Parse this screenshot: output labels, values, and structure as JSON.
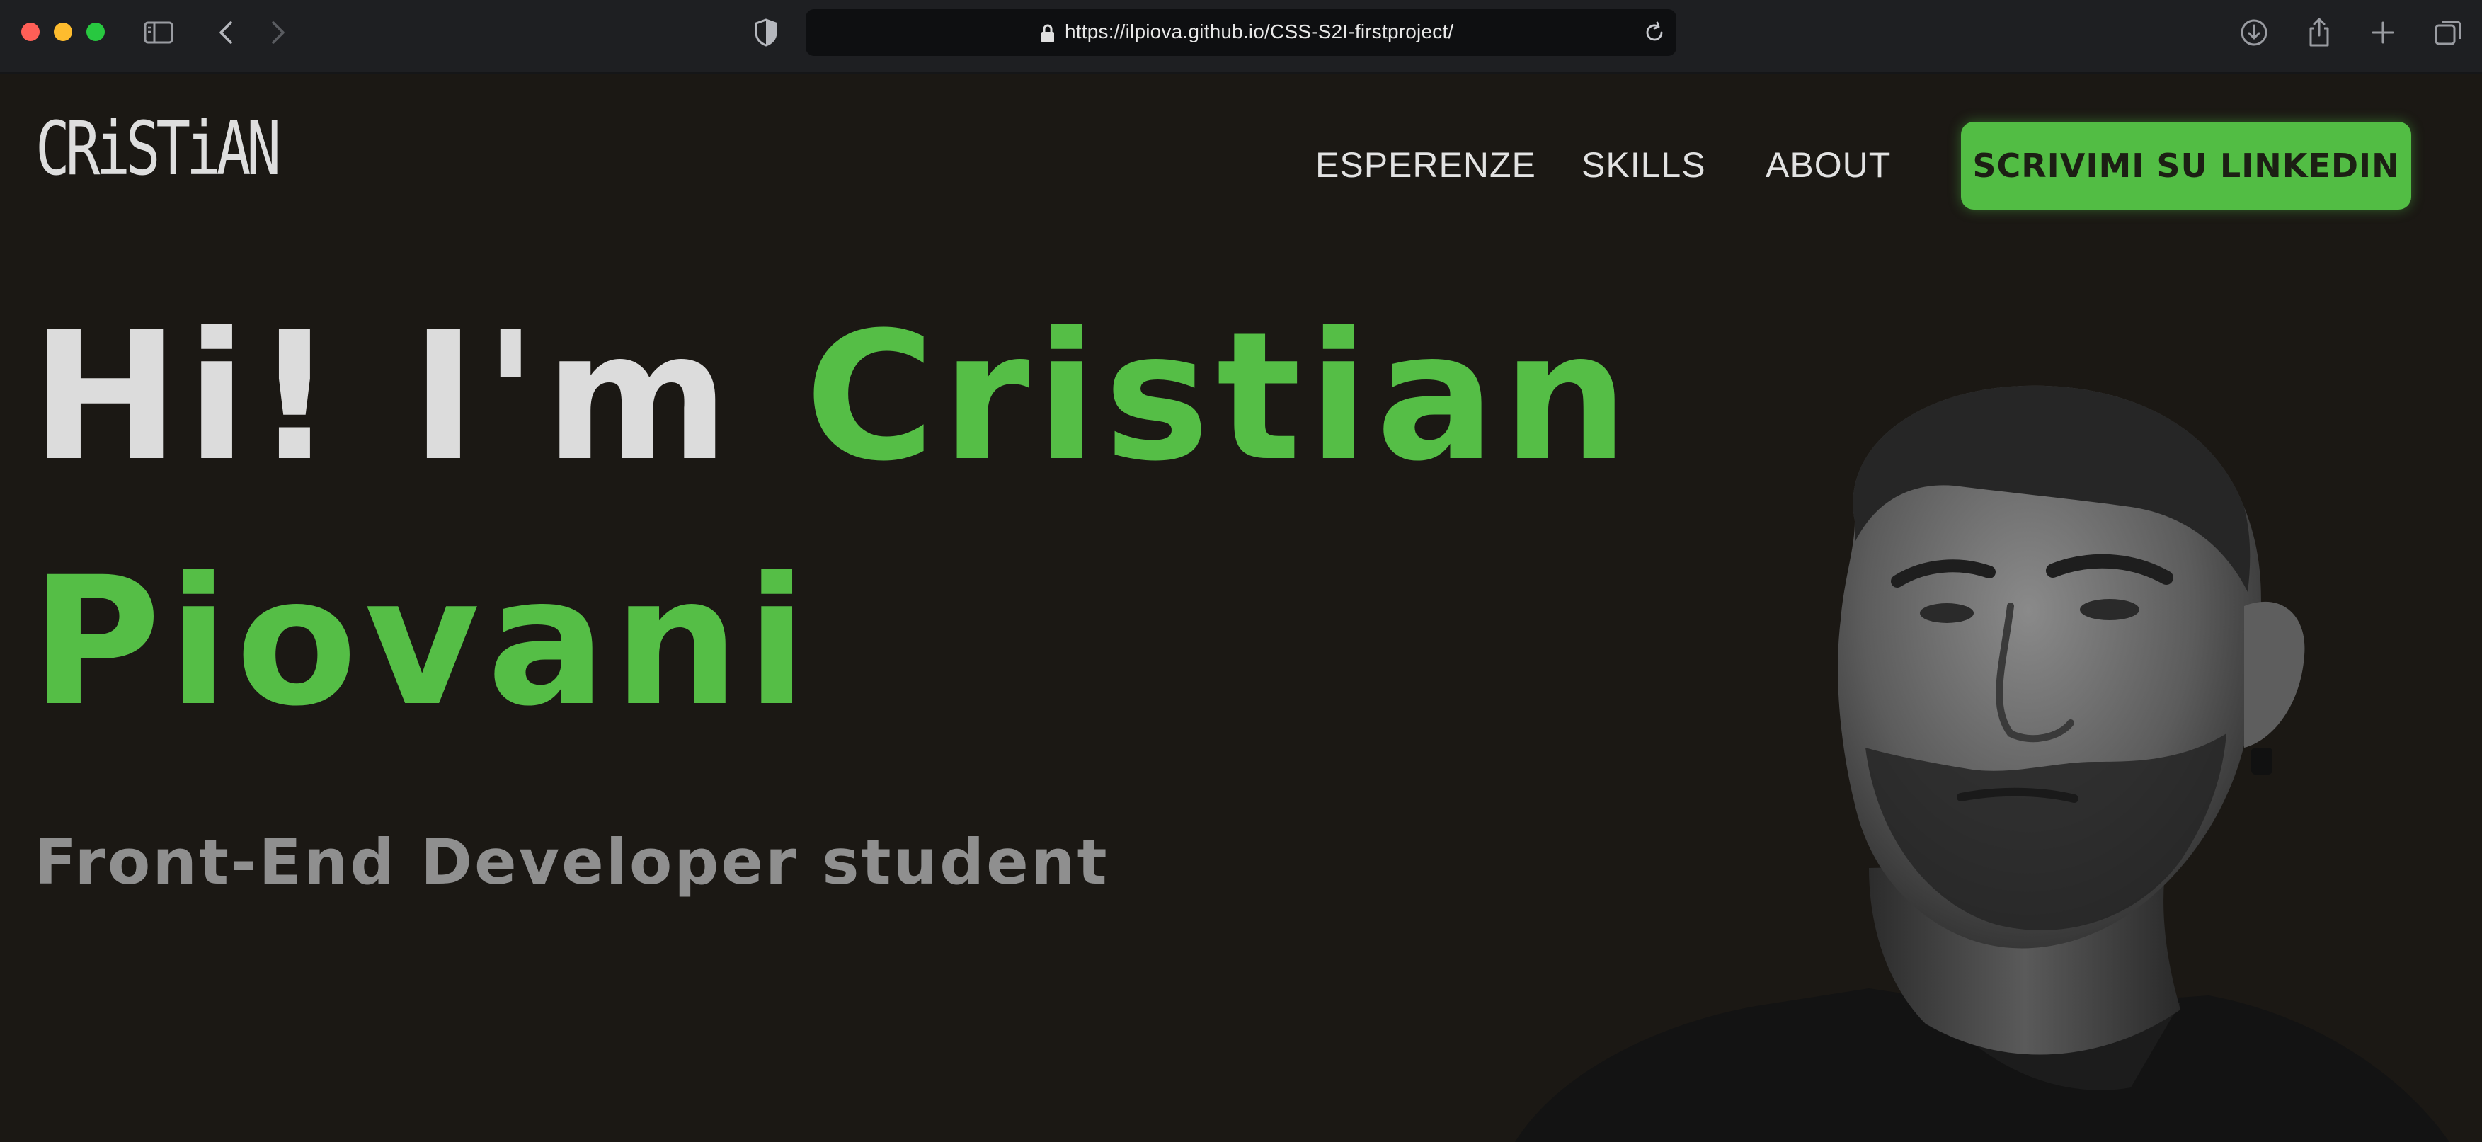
{
  "browser": {
    "url": "https://ilpiova.github.io/CSS-S2I-firstproject/",
    "icons": [
      "sidebar-icon",
      "back-icon",
      "forward-icon",
      "shield-icon",
      "lock-icon",
      "reload-icon",
      "download-icon",
      "share-icon",
      "new-tab-icon",
      "tabs-overview-icon"
    ]
  },
  "header": {
    "logo_text": "CRiSTiAN",
    "nav": [
      {
        "label": "ESPERENZE"
      },
      {
        "label": "SKILLS"
      },
      {
        "label": "ABOUT"
      }
    ],
    "cta_label": "SCRIVIMI SU LINKEDIN"
  },
  "hero": {
    "greeting": "Hi! I'm",
    "first_name": "Cristian",
    "last_name": "Piovani",
    "subtitle": "Front-End Developer student"
  },
  "colors": {
    "background": "#1b1814",
    "accent": "#52bd44",
    "text": "#dcdcdc",
    "subtitle": "#8f8f8f"
  }
}
